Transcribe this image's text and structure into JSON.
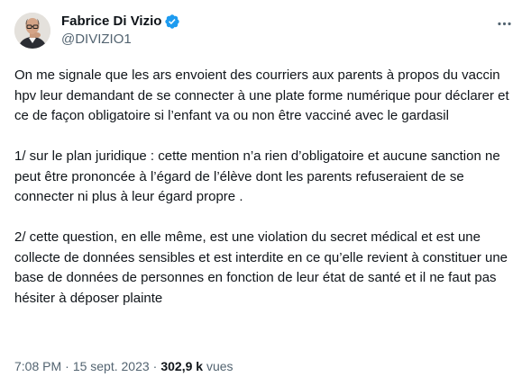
{
  "author": {
    "display_name": "Fabrice Di Vizio",
    "handle": "@DIVIZIO1",
    "verified": true,
    "verified_color": "#1d9bf0",
    "avatar_icon": "profile-photo"
  },
  "more_icon": "more-horizontal-icon",
  "tweet": {
    "paragraphs": [
      "On me signale que les ars envoient des courriers aux parents à propos du vaccin hpv leur demandant de se connecter à une plate forme numérique pour déclarer et ce de façon obligatoire si l’enfant va ou non être vacciné avec le gardasil",
      "1/ sur le plan juridique : cette mention n’a rien d’obligatoire et aucune sanction ne peut être prononcée à l’égard de l’élève dont les parents refuseraient de se connecter ni plus à leur égard propre .",
      "2/ cette question, en elle même, est une violation du secret médical et est une collecte de données sensibles et est interdite en ce qu’elle revient à constituer une base de données de personnes en fonction de leur état de santé et il ne faut pas hésiter à déposer plainte"
    ]
  },
  "meta": {
    "time": "7:08 PM",
    "separator": "·",
    "date": "15 sept. 2023",
    "views_count": "302,9 k",
    "views_label": "vues"
  },
  "colors": {
    "text_primary": "#0f1419",
    "text_secondary": "#536471",
    "background": "#ffffff"
  }
}
